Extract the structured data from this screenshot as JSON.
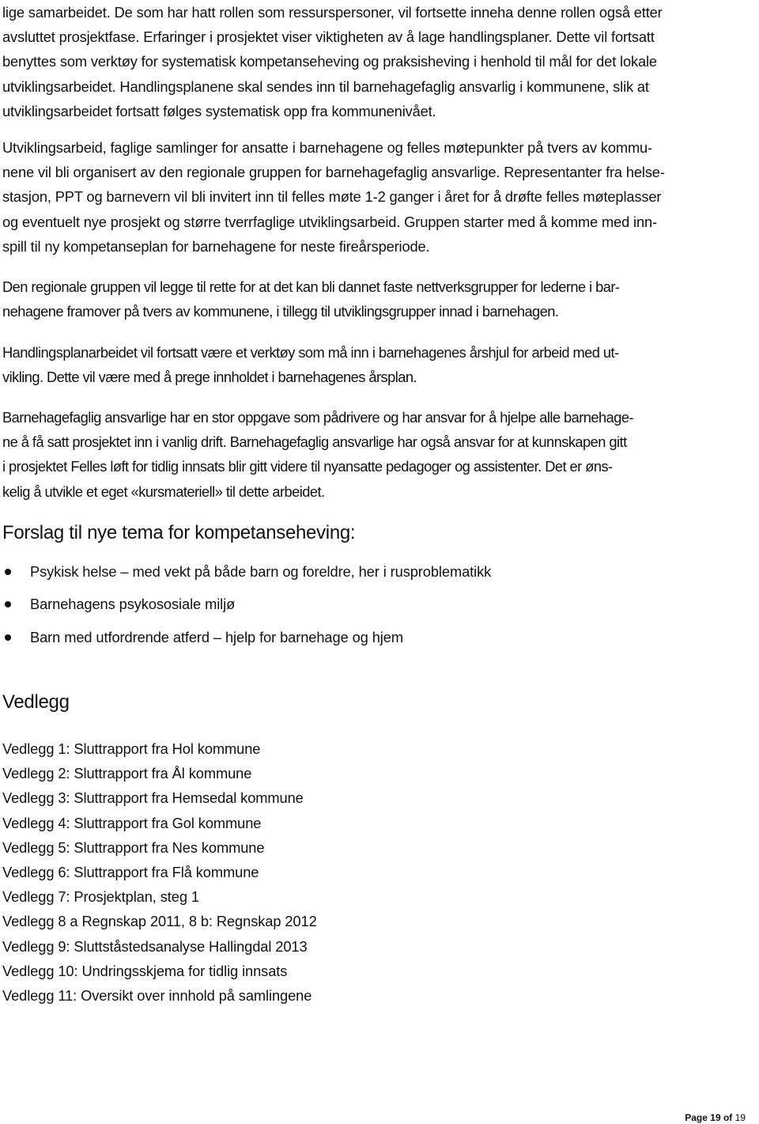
{
  "document": {
    "paragraphs": [
      {
        "lines": [
          "lige samarbeidet. De som har hatt rollen som ressurspersoner, vil fortsette inneha denne rollen også etter",
          "avsluttet prosjektfase. Erfaringer i prosjektet viser viktigheten av å lage handlingsplaner. Dette vil fortsatt",
          "benyttes som verktøy for systematisk kompetanseheving og praksisheving i henhold til mål for det lokale",
          "utviklingsarbeidet. Handlingsplanene skal sendes inn til barnehagefaglig ansvarlig i kommunene, slik at",
          "utviklingsarbeidet fortsatt følges systematisk opp fra kommunenivået."
        ]
      },
      {
        "lines": [
          "Utviklingsarbeid, faglige samlinger for ansatte i barnehagene og felles møtepunkter på tvers av kommu-",
          "nene vil bli organisert av den regionale gruppen for barnehagefaglig ansvarlige.  Representanter fra helse-",
          "stasjon, PPT og barnevern vil bli invitert inn til felles møte 1-2 ganger i året for å drøfte felles møteplasser",
          "og eventuelt nye prosjekt og større tverrfaglige utviklingsarbeid. Gruppen starter med å komme med inn-",
          "spill til ny kompetanseplan for barnehagene for neste fireårsperiode."
        ]
      },
      {
        "lines": [
          "Den regionale gruppen vil legge til rette for at det kan bli dannet faste nettverksgrupper for lederne i bar-",
          "nehagene framover på tvers av kommunene, i tillegg til utviklingsgrupper innad i barnehagen."
        ]
      },
      {
        "lines": [
          "Handlingsplanarbeidet vil fortsatt være et verktøy som må inn i barnehagenes årshjul for arbeid med ut-",
          "vikling. Dette vil være med å prege innholdet i barnehagenes årsplan."
        ]
      },
      {
        "lines": [
          "Barnehagefaglig ansvarlige har en stor oppgave som pådrivere og har ansvar for å hjelpe alle barnehage-",
          "ne å få satt prosjektet inn i vanlig drift.  Barnehagefaglig ansvarlige har også ansvar for at kunnskapen gitt",
          "i prosjektet Felles løft for tidlig innsats blir gitt videre til nyansatte pedagoger og assistenter. Det er øns-",
          "kelig å utvikle et eget «kursmateriell» til dette arbeidet."
        ]
      }
    ],
    "section_competence": {
      "heading": "Forslag til nye tema for kompetanseheving:",
      "bullets": [
        "Psykisk helse – med vekt på både barn og foreldre, her i rusproblematikk",
        "Barnehagens psykososiale miljø",
        "Barn med utfordrende atferd – hjelp for barnehage og hjem"
      ]
    },
    "section_attachments": {
      "heading": "Vedlegg",
      "items": [
        "Vedlegg 1: Sluttrapport fra Hol kommune",
        "Vedlegg 2: Sluttrapport fra Ål kommune",
        "Vedlegg 3: Sluttrapport fra Hemsedal kommune",
        "Vedlegg 4: Sluttrapport fra Gol kommune",
        "Vedlegg 5: Sluttrapport fra Nes kommune",
        "Vedlegg 6: Sluttrapport fra Flå kommune",
        "Vedlegg 7: Prosjektplan, steg 1",
        "Vedlegg 8 a Regnskap 2011, 8 b: Regnskap 2012",
        "Vedlegg 9: Sluttståstedsanalyse Hallingdal 2013",
        "Vedlegg 10: Undringsskjema for tidlig innsats",
        "Vedlegg 11: Oversikt over innhold på samlingene"
      ]
    },
    "footer": {
      "page_label": "Page",
      "current_page": "19",
      "of_label": "of",
      "total_pages": "19"
    }
  }
}
